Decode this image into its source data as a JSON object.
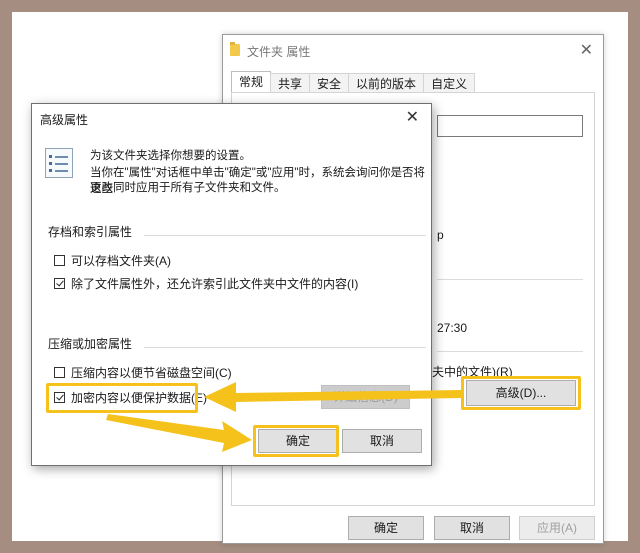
{
  "props": {
    "title": "文件夹 属性",
    "close": "✕",
    "tabs": [
      "常规",
      "共享",
      "安全",
      "以前的版本",
      "自定义"
    ],
    "fragments": {
      "p": "p",
      "time": "27:30",
      "compress": "夫中的文件)(R)"
    },
    "advanced_button": "高级(D)...",
    "ok": "确定",
    "cancel": "取消",
    "apply": "应用(A)"
  },
  "dialog": {
    "title": "高级属性",
    "close": "✕",
    "desc_line1": "为该文件夹选择你想要的设置。",
    "desc_line2": "当你在\"属性\"对话框中单击\"确定\"或\"应用\"时，系统会询问你是否将这些",
    "desc_line3": "更改同时应用于所有子文件夹和文件。",
    "archive_group": "存档和索引属性",
    "archive_check": "可以存档文件夹(A)",
    "index_check": "除了文件属性外，还允许索引此文件夹中文件的内容(I)",
    "compress_group": "压缩或加密属性",
    "compress_check": "压缩内容以便节省磁盘空间(C)",
    "encrypt_check": "加密内容以便保护数据(E)",
    "details": "详细信息(D)",
    "ok": "确定",
    "cancel": "取消"
  },
  "state": {
    "archive_checked": false,
    "index_checked": true,
    "compress_checked": false,
    "encrypt_checked": true
  },
  "colors": {
    "highlight": "#f5c21b",
    "background": "#a58e81"
  }
}
